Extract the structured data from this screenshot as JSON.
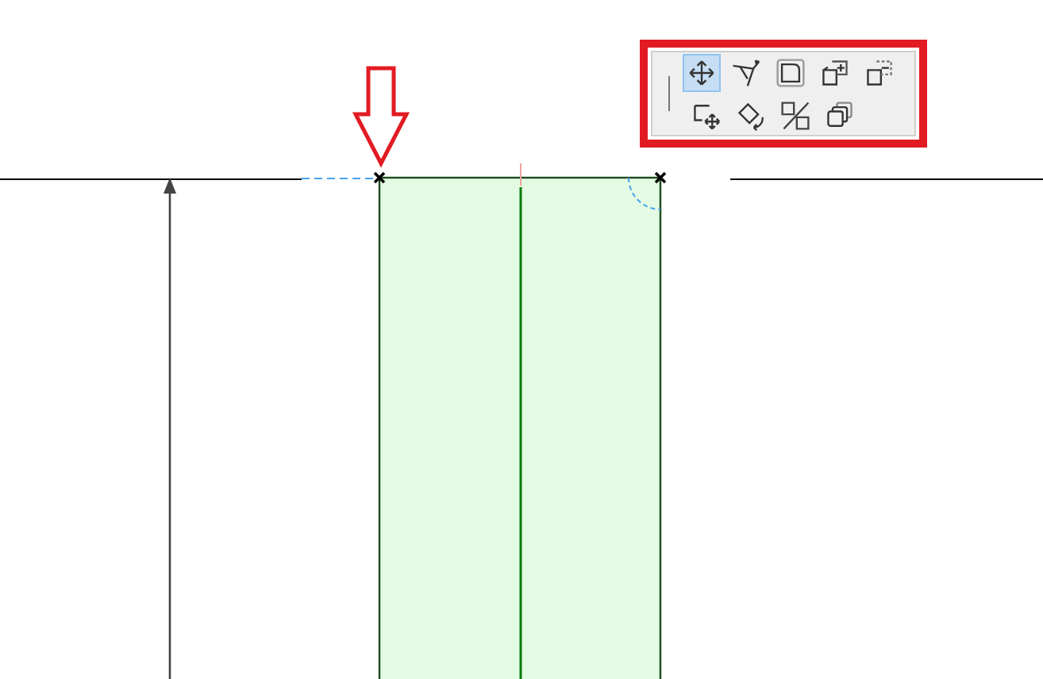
{
  "palette": {
    "highlighted": true,
    "tools": [
      {
        "kind": "drag",
        "selected": true
      },
      {
        "kind": "offset",
        "selected": false
      },
      {
        "kind": "fillet",
        "selected": false
      },
      {
        "kind": "add-polygon",
        "selected": false
      },
      {
        "kind": "subtract-polygon",
        "selected": false
      },
      {
        "kind": "move-node",
        "selected": false
      },
      {
        "kind": "rotate",
        "selected": false
      },
      {
        "kind": "mirror",
        "selected": false
      },
      {
        "kind": "copy",
        "selected": false
      }
    ]
  }
}
